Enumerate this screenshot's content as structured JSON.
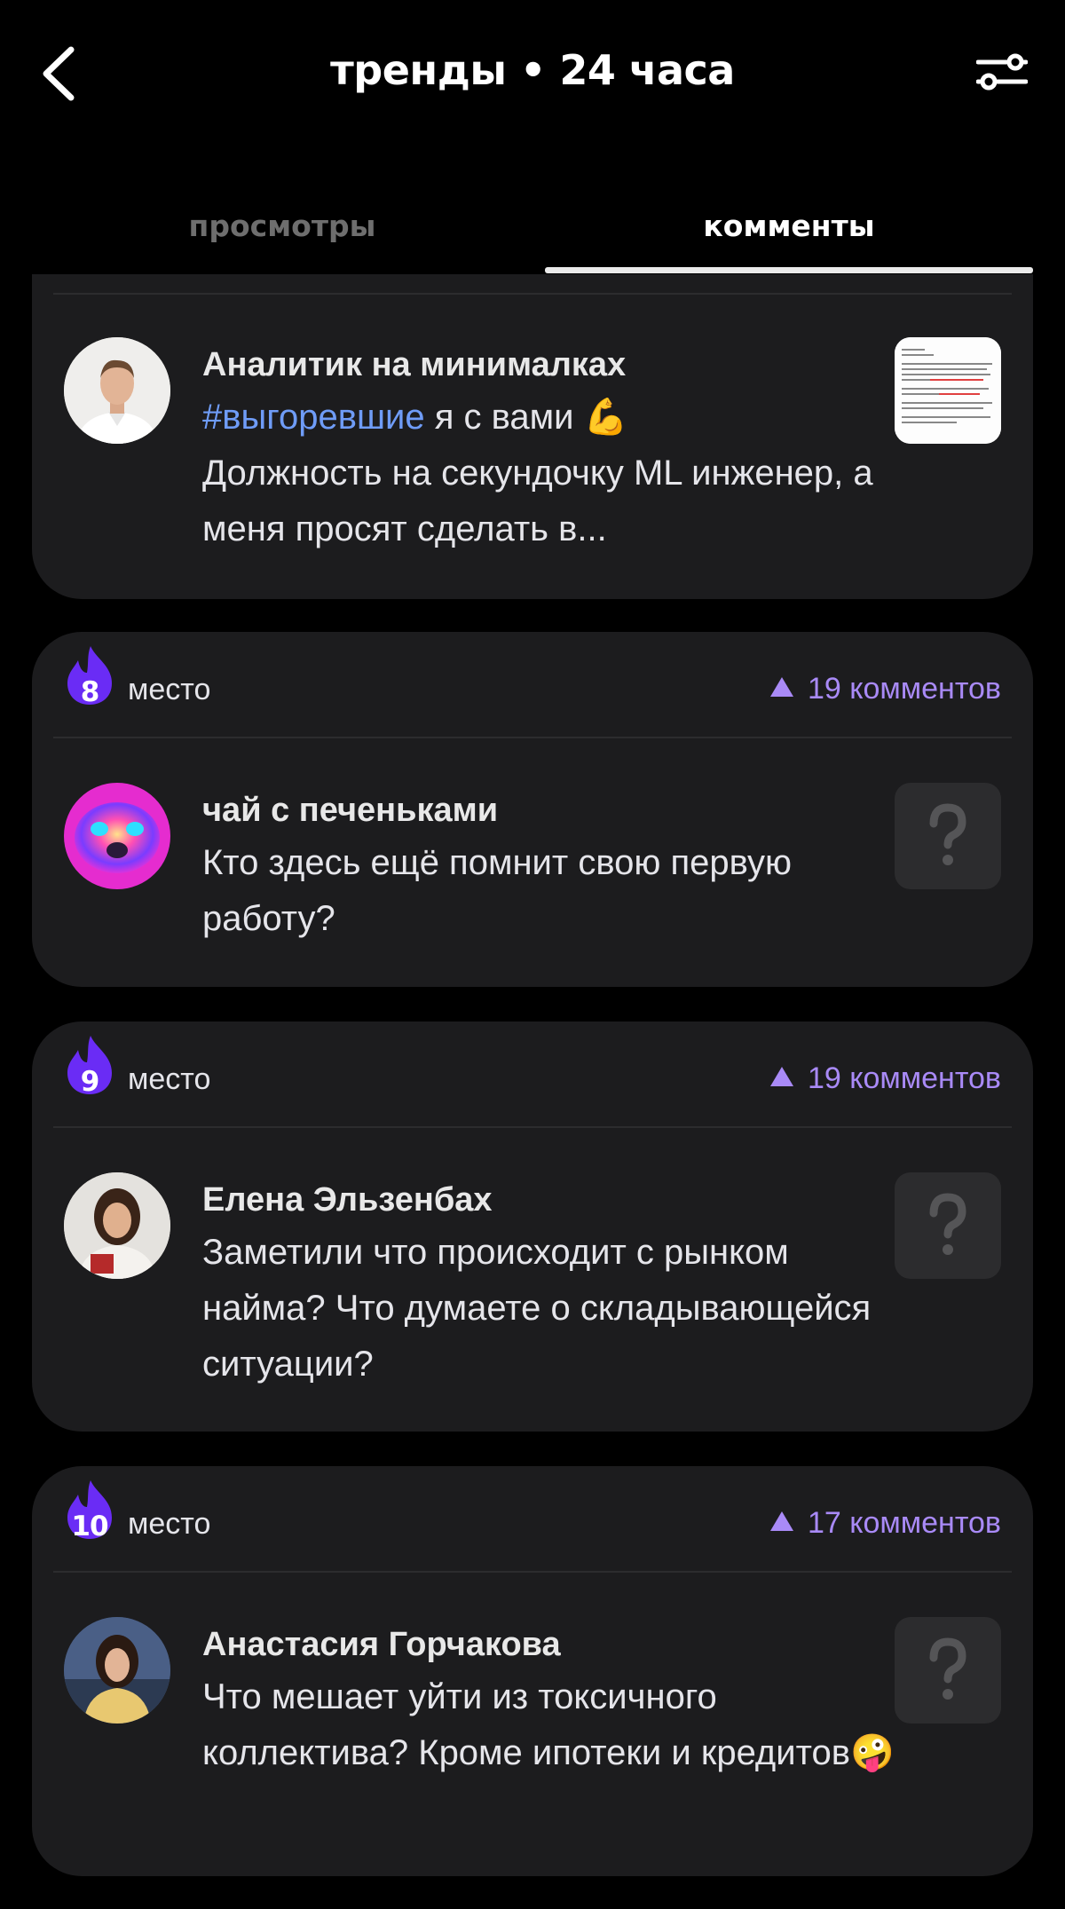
{
  "header": {
    "title": "тренды • 24 часа",
    "back_icon": "chevron-left-icon",
    "filter_icon": "sliders-icon"
  },
  "tabs": [
    {
      "label": "просмотры",
      "active": false
    },
    {
      "label": "комменты",
      "active": true
    }
  ],
  "colors": {
    "background": "#000000",
    "card": "#1c1c1e",
    "accent": "#a98af7",
    "flame": "#6a2cf5",
    "hashtag": "#6f9cf7"
  },
  "top_post": {
    "author": "Аналитик на минималках",
    "hashtag": "#выгоревшие",
    "text_rest": " я с вами 💪",
    "text_more": "Должность на секундочку ML инженер, а меня просят сделать в..."
  },
  "posts": [
    {
      "rank": "8",
      "place_label": "место",
      "comments": "19 комментов",
      "author": "чай с печеньками",
      "text": "Кто здесь ещё помнит свою первую работу?"
    },
    {
      "rank": "9",
      "place_label": "место",
      "comments": "19 комментов",
      "author": "Елена Эльзенбах",
      "text": "Заметили что происходит с рынком найма? Что думаете о складывающейся ситуации?"
    },
    {
      "rank": "10",
      "place_label": "место",
      "comments": "17 комментов",
      "author": "Анастасия Горчакова",
      "text": "Что мешает уйти из токсичного коллектива? Кроме ипотеки и кредитов🤪"
    }
  ]
}
